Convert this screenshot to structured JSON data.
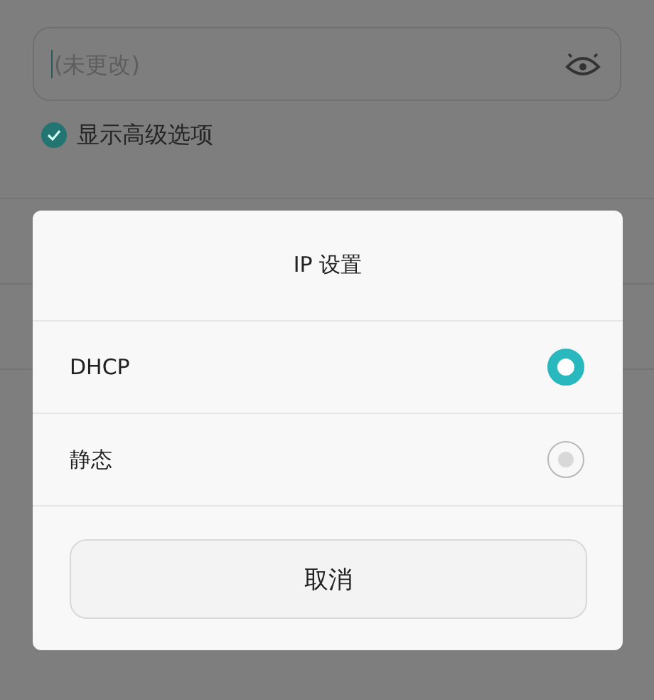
{
  "password_field": {
    "placeholder": "(未更改)"
  },
  "show_advanced": {
    "label": "显示高级选项",
    "checked": true
  },
  "dialog": {
    "title": "IP 设置",
    "options": [
      {
        "label": "DHCP",
        "selected": true
      },
      {
        "label": "静态",
        "selected": false
      }
    ],
    "cancel_button": "取消"
  }
}
